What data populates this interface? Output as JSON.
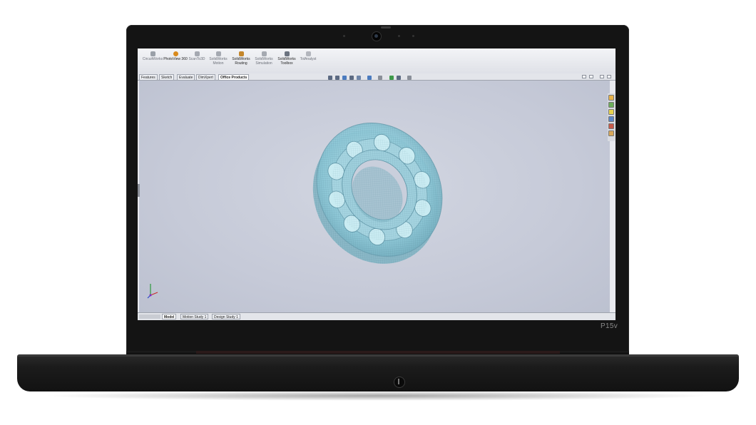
{
  "device": {
    "model_label": "P15v"
  },
  "ribbon": {
    "items": [
      {
        "label": "CircuitWorks",
        "icon": "circuitworks-icon",
        "color": "#9aa0a8"
      },
      {
        "label": "PhotoView 360",
        "icon": "photoview-icon",
        "color": "#d98a1c",
        "active": true
      },
      {
        "label": "ScanTo3D",
        "icon": "scanto3d-icon",
        "color": "#a5a9b1"
      },
      {
        "label": "SolidWorks Motion",
        "icon": "motion-icon",
        "color": "#a5a9b1"
      },
      {
        "label": "SolidWorks Routing",
        "icon": "routing-icon",
        "color": "#c4862b",
        "active": true
      },
      {
        "label": "SolidWorks Simulation",
        "icon": "simulation-icon",
        "color": "#a5a9b1"
      },
      {
        "label": "SolidWorks Toolbox",
        "icon": "toolbox-icon",
        "color": "#6c7380",
        "active": true
      },
      {
        "label": "TolAnalyst",
        "icon": "tolanalyst-icon",
        "color": "#b3b6bd"
      }
    ]
  },
  "command_tabs": [
    "Features",
    "Sketch",
    "Evaluate",
    "DimXpert",
    "Office Products"
  ],
  "active_command_tab": "Office Products",
  "bottom_tabs": [
    "Model",
    "Motion Study 1",
    "Design Study 1"
  ],
  "active_bottom_tab": "Model",
  "model": {
    "name": "ball bearing",
    "display": "transparent wireframe",
    "color": "#8ec9d8"
  },
  "colors": {
    "viewport": "#c6cad8",
    "bezel": "#141414"
  }
}
